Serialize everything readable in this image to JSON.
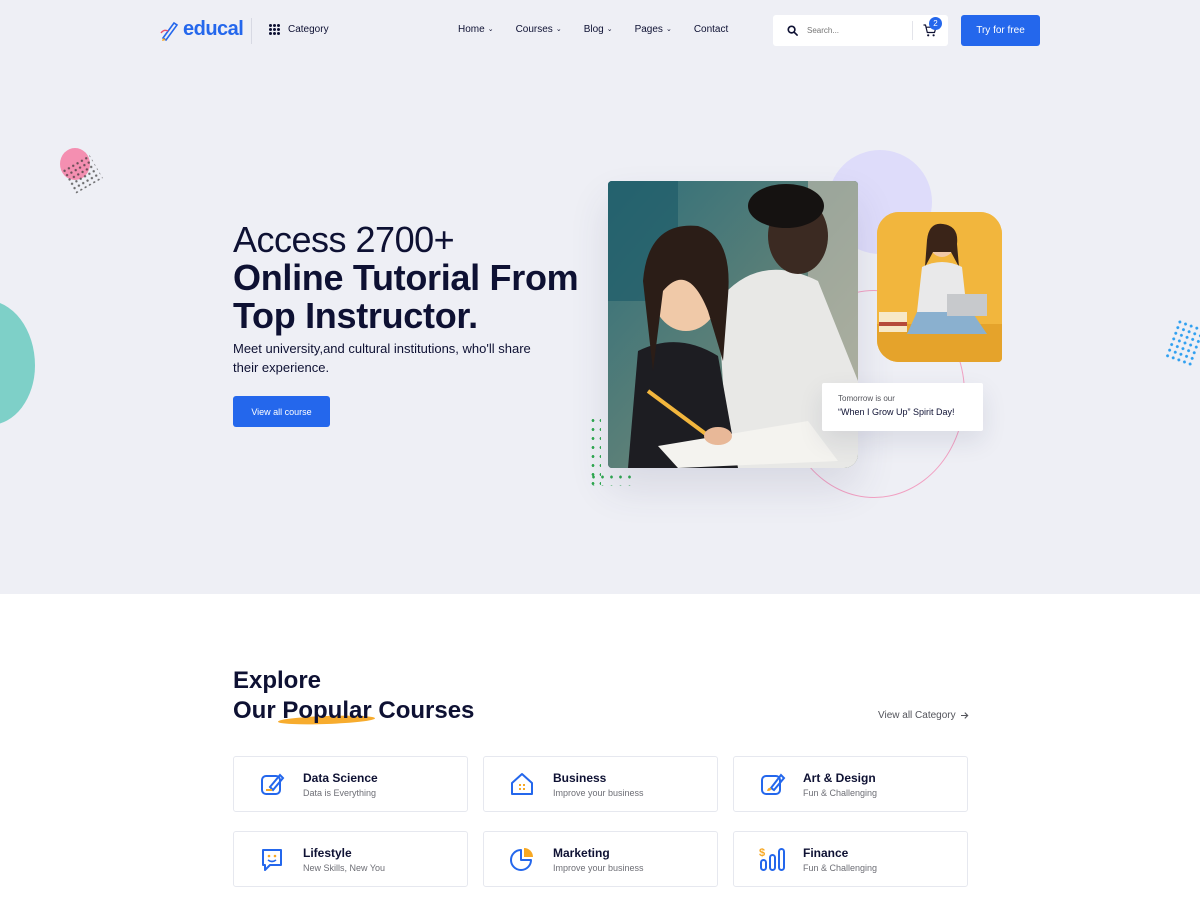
{
  "header": {
    "logo_text": "educal",
    "category_label": "Category",
    "nav": [
      {
        "label": "Home",
        "has_dropdown": true
      },
      {
        "label": "Courses",
        "has_dropdown": true
      },
      {
        "label": "Blog",
        "has_dropdown": true
      },
      {
        "label": "Pages",
        "has_dropdown": true
      },
      {
        "label": "Contact",
        "has_dropdown": false
      }
    ],
    "search_placeholder": "Search...",
    "cart_count": "2",
    "cta_label": "Try for free"
  },
  "hero": {
    "line1": "Access 2700+",
    "line2_highlight": "Online",
    "line2_rest": " Tutorial From",
    "line3": "Top Instructor.",
    "subtitle": "Meet university,and cultural institutions, who'll share their experience.",
    "button_label": "View all course",
    "card_small": "Tomorrow is our",
    "card_big": "“When I Grow Up” Spirit Day!"
  },
  "courses_section": {
    "title_line1": "Explore",
    "title_pre": "Our ",
    "title_highlight": "Popular",
    "title_post": " Courses",
    "view_all_label": "View all Category",
    "categories": [
      {
        "title": "Data Science",
        "subtitle": "Data is Everything",
        "icon": "data-science-icon"
      },
      {
        "title": "Business",
        "subtitle": "Improve your business",
        "icon": "business-icon"
      },
      {
        "title": "Art & Design",
        "subtitle": "Fun & Challenging",
        "icon": "art-design-icon"
      },
      {
        "title": "Lifestyle",
        "subtitle": "New Skills, New You",
        "icon": "lifestyle-icon"
      },
      {
        "title": "Marketing",
        "subtitle": "Improve your business",
        "icon": "marketing-icon"
      },
      {
        "title": "Finance",
        "subtitle": "Fun & Challenging",
        "icon": "finance-icon"
      }
    ]
  },
  "colors": {
    "primary": "#2467ec",
    "heading": "#0e1133",
    "highlight": "#f7a823",
    "hero_bg": "#eeeff5"
  }
}
